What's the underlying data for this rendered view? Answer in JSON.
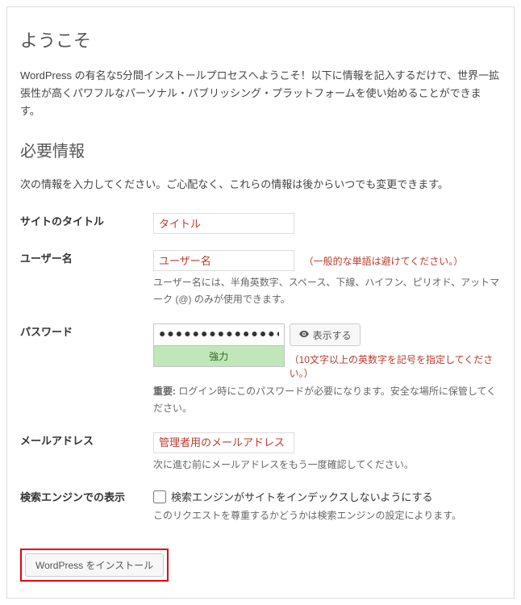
{
  "welcome_heading": "ようこそ",
  "welcome_intro": "WordPress の有名な5分間インストールプロセスへようこそ！以下に情報を記入するだけで、世界一拡張性が高くパワフルなパーソナル・パブリッシング・プラットフォームを使い始めることができます。",
  "info_heading": "必要情報",
  "info_sub": "次の情報を入力してください。ご心配なく、これらの情報は後からいつでも変更できます。",
  "fields": {
    "site_title": {
      "label": "サイトのタイトル",
      "placeholder": "タイトル"
    },
    "username": {
      "label": "ユーザー名",
      "placeholder": "ユーザー名",
      "hint_red": "（一般的な単語は避けてください。）",
      "desc": "ユーザー名には、半角英数字、スペース、下線、ハイフン、ピリオド、アットマーク (@) のみが使用できます。"
    },
    "password": {
      "label": "パスワード",
      "value_mask": "●●●●●●●●●●●●●●●●●●●",
      "strength": "強力",
      "show_btn": "表示する",
      "hint_red": "（10文字以上の英数字を記号を指定してください。）",
      "desc_prefix": "重要:",
      "desc": " ログイン時にこのパスワードが必要になります。安全な場所に保管してください。"
    },
    "email": {
      "label": "メールアドレス",
      "placeholder": "管理者用のメールアドレス",
      "desc": "次に進む前にメールアドレスをもう一度確認してください。"
    },
    "search_visibility": {
      "label": "検索エンジンでの表示",
      "checkbox_label": "検索エンジンがサイトをインデックスしないようにする",
      "desc": "このリクエストを尊重するかどうかは検索エンジンの設定によります。"
    }
  },
  "submit_label": "WordPress をインストール"
}
